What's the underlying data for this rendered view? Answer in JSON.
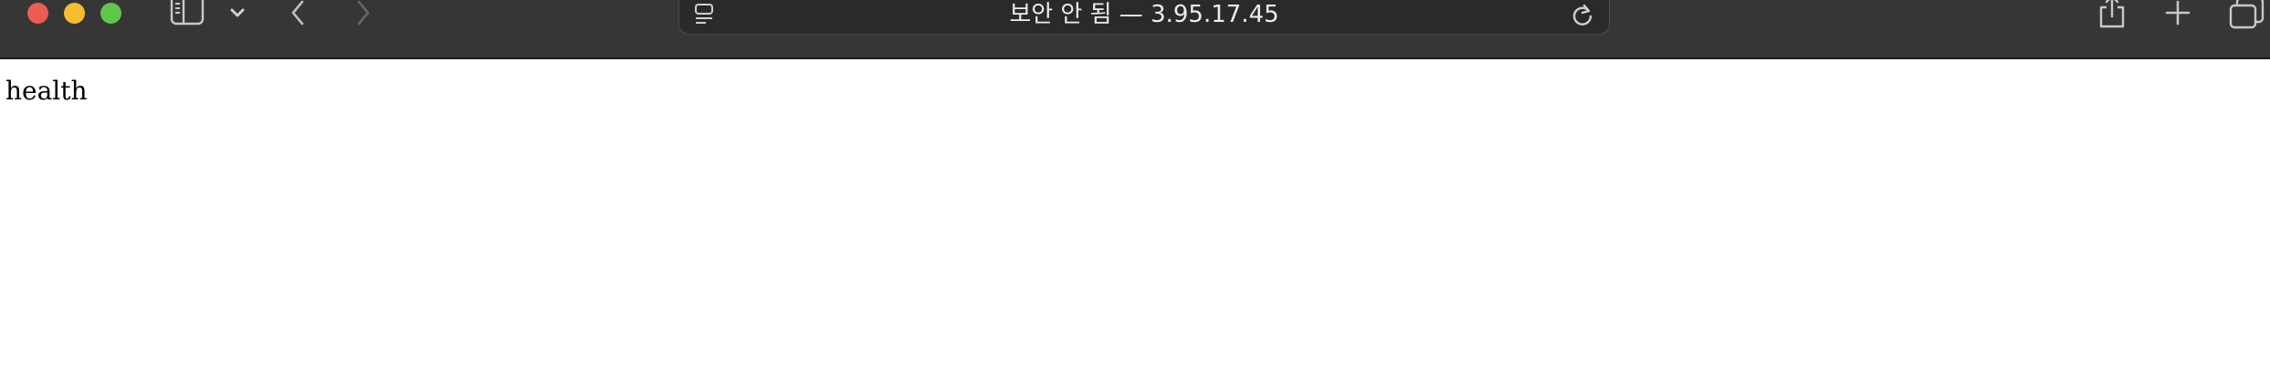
{
  "browser": {
    "address_bar": {
      "text": "보안 안 됨 — 3.95.17.45"
    },
    "icons": {
      "sidebar_toggle": "sidebar-icon",
      "tab_group": "chevron-down-icon",
      "back": "chevron-left-icon",
      "forward": "chevron-right-icon",
      "reader": "reader-mode-icon",
      "reload": "reload-icon",
      "share": "share-icon",
      "new_tab": "plus-icon",
      "tabs_overview": "tabs-overview-icon"
    },
    "colors": {
      "toolbar_bg": "#363636",
      "close": "#ee5b52",
      "minimize": "#f5bd30",
      "zoom": "#5fc64a"
    }
  },
  "page": {
    "body_text": "health"
  }
}
